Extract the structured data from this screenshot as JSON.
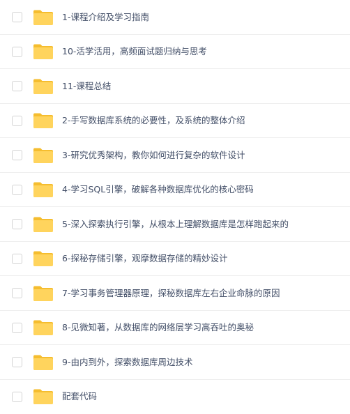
{
  "colors": {
    "folder_body": "#ffd45d",
    "folder_tab": "#f5bd2f",
    "text": "#424e67",
    "checkbox_border": "#d3d3d3",
    "divider": "#efefef"
  },
  "icon": "folder-icon",
  "items": [
    {
      "label": "1-课程介绍及学习指南",
      "checked": false
    },
    {
      "label": "10-活学活用，高频面试题归纳与思考",
      "checked": false
    },
    {
      "label": "11-课程总结",
      "checked": false
    },
    {
      "label": "2-手写数据库系统的必要性，及系统的整体介绍",
      "checked": false
    },
    {
      "label": "3-研究优秀架构，教你如何进行复杂的软件设计",
      "checked": false
    },
    {
      "label": "4-学习SQL引擎，破解各种数据库优化的核心密码",
      "checked": false
    },
    {
      "label": "5-深入探索执行引擎，从根本上理解数据库是怎样跑起来的",
      "checked": false
    },
    {
      "label": "6-探秘存储引擎，观摩数据存储的精妙设计",
      "checked": false
    },
    {
      "label": "7-学习事务管理器原理，探秘数据库左右企业命脉的原因",
      "checked": false
    },
    {
      "label": "8-见微知著，从数据库的网络层学习高吞吐的奥秘",
      "checked": false
    },
    {
      "label": "9-由内到外，探索数据库周边技术",
      "checked": false
    },
    {
      "label": "配套代码",
      "checked": false
    }
  ]
}
